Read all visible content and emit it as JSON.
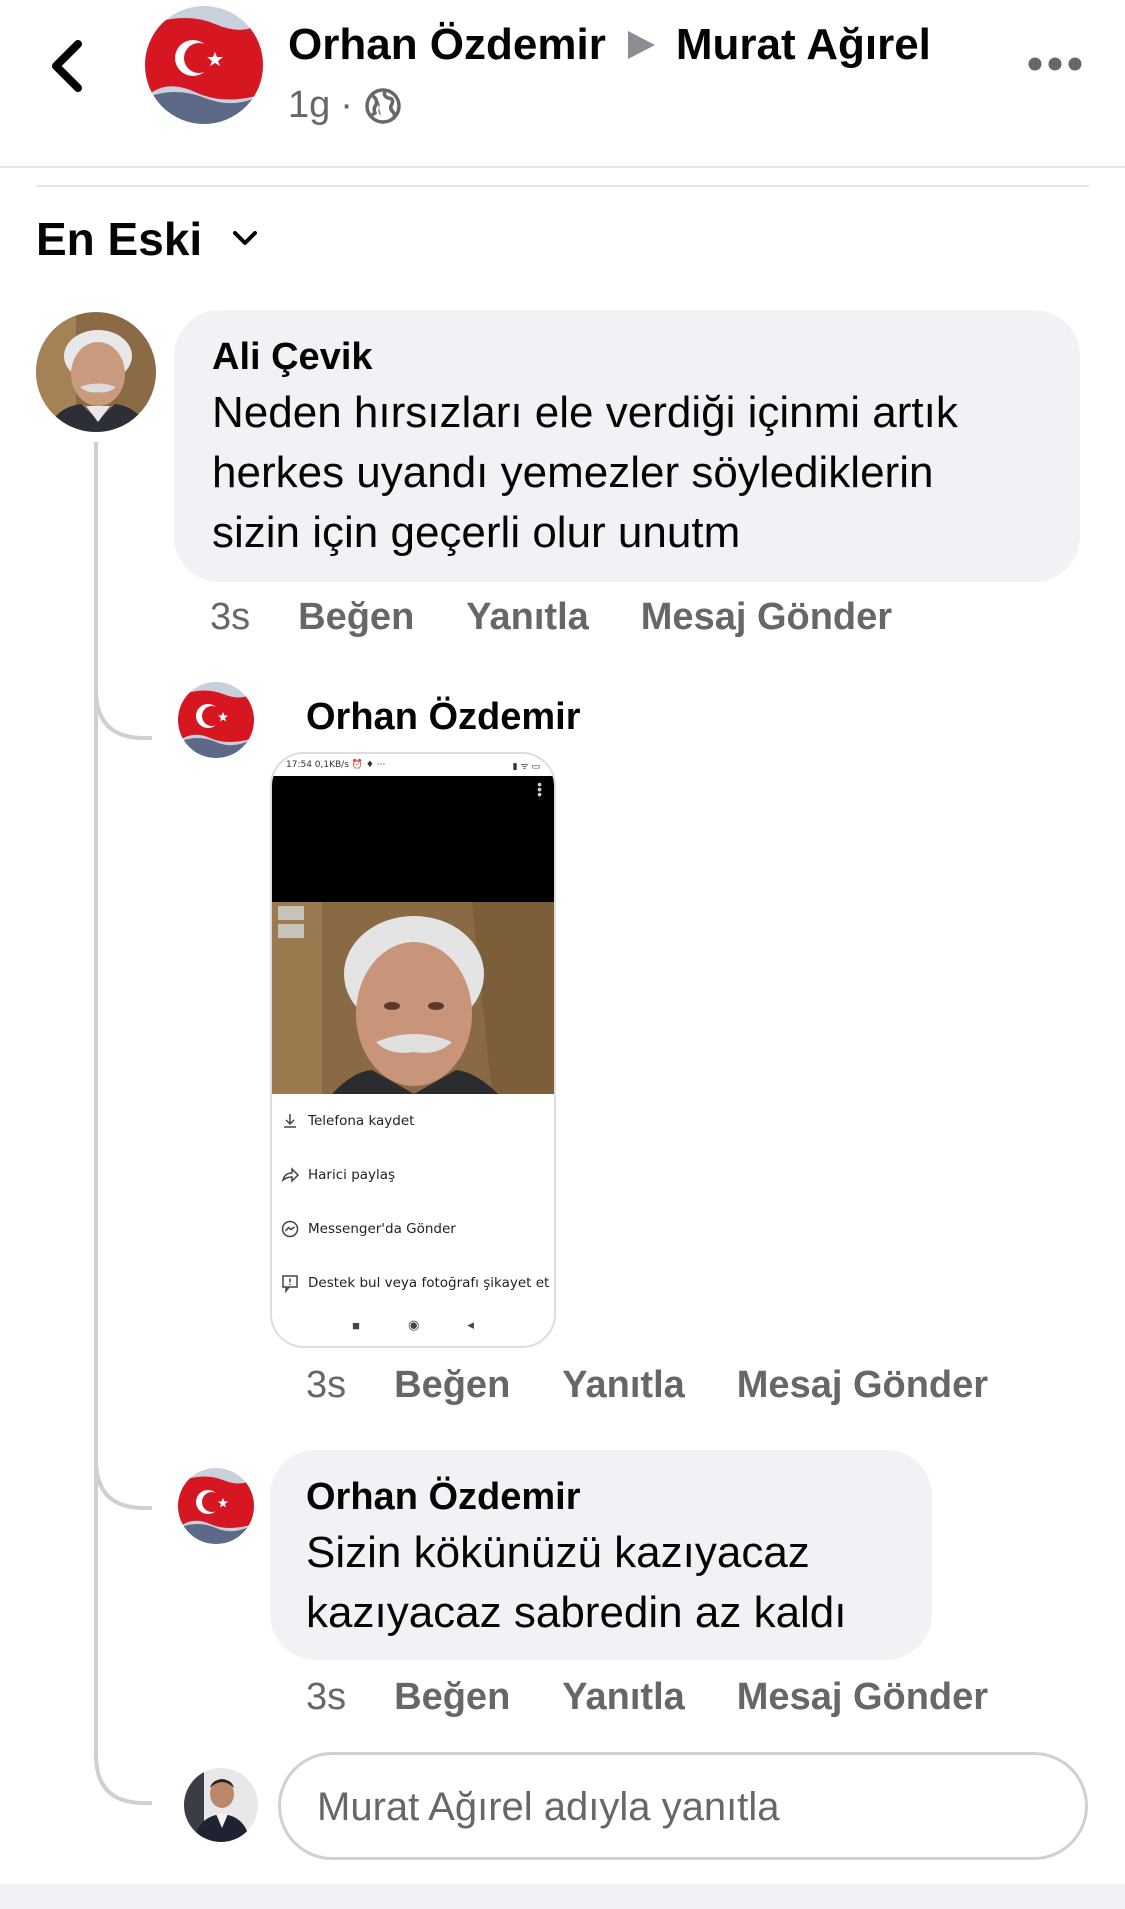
{
  "header": {
    "author": "Orhan Özdemir",
    "target": "Murat Ağırel",
    "time": "1g",
    "separator": "·"
  },
  "sort": {
    "label": "En Eski"
  },
  "comments": [
    {
      "author": "Ali Çevik",
      "text_lines": [
        "Neden hırsızları ele verdiği içinmi  artık",
        "herkes uyandı yemezler söylediklerin",
        "sizin için geçerli olur unutm"
      ],
      "time": "3s",
      "actions": [
        "Beğen",
        "Yanıtla",
        "Mesaj Gönder"
      ]
    }
  ],
  "replies": [
    {
      "author": "Orhan Özdemir",
      "time": "3s",
      "actions": [
        "Beğen",
        "Yanıtla",
        "Mesaj Gönder"
      ],
      "attachment": {
        "status_left": "17:54  0,1KB/s ⏰ ♦  ···",
        "status_right": "▮ ᯤ ▭",
        "menu": [
          {
            "icon": "download-icon",
            "label": "Telefona kaydet"
          },
          {
            "icon": "share-icon",
            "label": "Harici paylaş"
          },
          {
            "icon": "messenger-icon",
            "label": "Messenger'da Gönder"
          },
          {
            "icon": "report-icon",
            "label": "Destek bul veya fotoğrafı şikayet et"
          }
        ]
      }
    },
    {
      "author": "Orhan Özdemir",
      "text_lines": [
        "Sizin kökünüzü kazıyacaz",
        "kazıyacaz sabredin az kaldı"
      ],
      "time": "3s",
      "actions": [
        "Beğen",
        "Yanıtla",
        "Mesaj Gönder"
      ]
    }
  ],
  "reply_box": {
    "placeholder": "Murat Ağırel adıyla yanıtla"
  },
  "colors": {
    "bubble": "#f0f2f5",
    "secondary_text": "#65676b",
    "divider": "#e4e6eb",
    "flag_red": "#e30a17"
  }
}
